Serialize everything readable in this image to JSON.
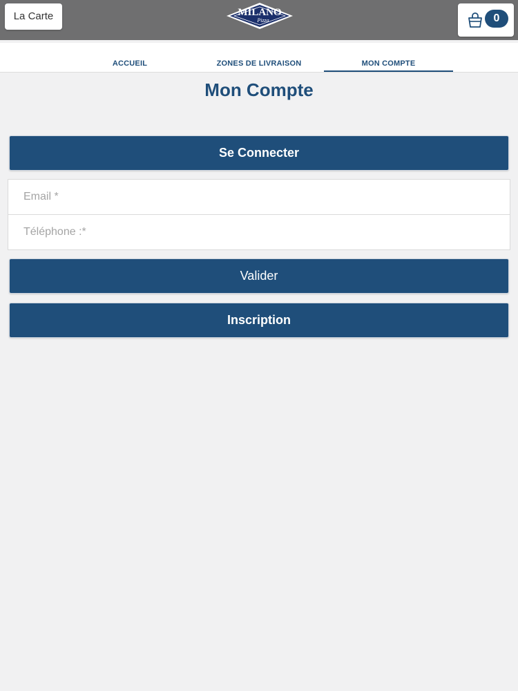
{
  "header": {
    "menu_label": "La Carte",
    "logo": {
      "brand": "MILANO",
      "tagline": "Pizza",
      "colors": {
        "navy": "#1b2f6b",
        "light": "#ffffff"
      }
    },
    "cart": {
      "icon": "shopping-bag-icon",
      "count": "0"
    }
  },
  "tabs": [
    {
      "label": "ACCUEIL",
      "active": false
    },
    {
      "label": "ZONES DE LIVRAISON",
      "active": false
    },
    {
      "label": "MON COMPTE",
      "active": true
    }
  ],
  "page": {
    "title": "Mon Compte",
    "connect_label": "Se Connecter",
    "email": {
      "value": "",
      "placeholder": "Email *"
    },
    "phone": {
      "value": "",
      "placeholder": "Téléphone :*"
    },
    "submit_label": "Valider",
    "signup_label": "Inscription"
  },
  "colors": {
    "top_bar": "#6f6f70",
    "accent": "#1f4e7a",
    "background": "#f1f1f2"
  }
}
